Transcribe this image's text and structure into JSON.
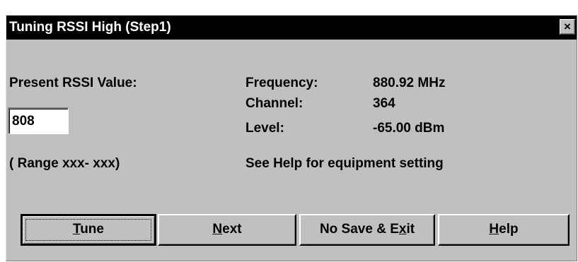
{
  "dialog": {
    "title": "Tuning RSSI High (Step1)",
    "close_label": "×"
  },
  "left": {
    "present_label": "Present RSSI Value:",
    "rssi_value": "808",
    "range_text": "( Range xxx- xxx)"
  },
  "right": {
    "frequency_label": "Frequency:",
    "frequency_value": "880.92  MHz",
    "channel_label": "Channel:",
    "channel_value": "364",
    "level_label": "Level:",
    "level_value": "-65.00 dBm",
    "help_hint": "See Help for equipment setting"
  },
  "buttons": {
    "tune": {
      "before": "",
      "mnemonic": "T",
      "after": "une"
    },
    "next": {
      "before": "",
      "mnemonic": "N",
      "after": "ext"
    },
    "nosave": {
      "before": "No Save & E",
      "mnemonic": "x",
      "after": "it"
    },
    "help": {
      "before": "",
      "mnemonic": "H",
      "after": "elp"
    }
  }
}
